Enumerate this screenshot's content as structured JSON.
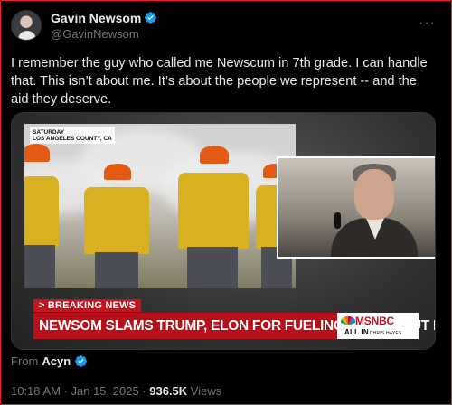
{
  "author": {
    "display_name": "Gavin Newsom",
    "handle": "@GavinNewsom",
    "verified_icon": "verified-badge-icon"
  },
  "tweet": {
    "text": "I remember the guy who called me Newscum in 7th grade. I can handle that. This isn’t about me. It’s about the people we represent -- and the aid they deserve."
  },
  "media": {
    "location_tag_line1": "SATURDAY",
    "location_tag_line2": "LOS ANGELES COUNTY, CA",
    "breaking_label": "> BREAKING NEWS",
    "headline": "NEWSOM SLAMS TRUMP, ELON FOR FUELING LIES ABOUT FIRES",
    "network": "MSNBC",
    "show_name": "ALL IN",
    "show_host": "CHRIS HAYES"
  },
  "source": {
    "prefix": "From",
    "name": "Acyn"
  },
  "meta": {
    "time": "10:18 AM",
    "separator": " · ",
    "date": "Jan 15, 2025",
    "views_count": "936.5K",
    "views_label": "Views"
  },
  "colors": {
    "verified": "#1d9bf0",
    "breaking_red": "#c3141f",
    "frame": "#f3212e"
  }
}
